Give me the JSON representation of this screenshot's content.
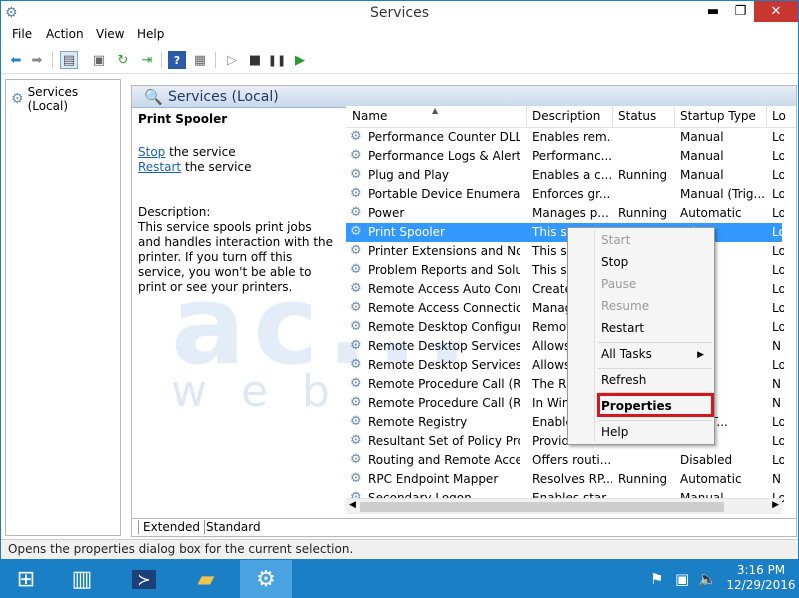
{
  "window": {
    "title": "Services",
    "minimize_glyph": "▬",
    "maximize_glyph": "❐",
    "close_glyph": "✕"
  },
  "menu": [
    "File",
    "Action",
    "View",
    "Help"
  ],
  "toolbar_icons": [
    "back-icon",
    "forward-icon",
    "show-hide-tree-icon",
    "properties-icon",
    "refresh-icon",
    "export-icon",
    "help-icon",
    "view-icon",
    "play-icon",
    "stop-icon",
    "pause-icon",
    "restart-icon"
  ],
  "tree": {
    "root_label": "Services (Local)"
  },
  "pane": {
    "header_title": "Services (Local)",
    "detail_title": "Print Spooler",
    "stop_link": "Stop",
    "stop_suffix": " the service",
    "restart_link": "Restart",
    "restart_suffix": " the service",
    "description_label": "Description:",
    "description_text": "This service spools print jobs and handles interaction with the printer. If you turn off this service, you won't be able to print or see your printers."
  },
  "columns": {
    "name": "Name",
    "description": "Description",
    "status": "Status",
    "startup_type": "Startup Type",
    "log_on": "Lo"
  },
  "rows": [
    {
      "name": "Performance Counter DLL ...",
      "description": "Enables rem...",
      "status": "",
      "startup": "Manual",
      "logon": "Lo"
    },
    {
      "name": "Performance Logs & Alerts",
      "description": "Performanc...",
      "status": "",
      "startup": "Manual",
      "logon": "Lo"
    },
    {
      "name": "Plug and Play",
      "description": "Enables a c...",
      "status": "Running",
      "startup": "Manual",
      "logon": "Lo"
    },
    {
      "name": "Portable Device Enumerator...",
      "description": "Enforces gr...",
      "status": "",
      "startup": "Manual (Trig...",
      "logon": "Lo"
    },
    {
      "name": "Power",
      "description": "Manages p...",
      "status": "Running",
      "startup": "Automatic",
      "logon": "Lo"
    },
    {
      "name": "Print Spooler",
      "description": "This se",
      "status": "",
      "startup": "atic",
      "logon": "Lo"
    },
    {
      "name": "Printer Extensions and Notif...",
      "description": "This se",
      "status": "",
      "startup": "l",
      "logon": "Lo"
    },
    {
      "name": "Problem Reports and Soluti...",
      "description": "This se",
      "status": "",
      "startup": "l",
      "logon": "Lo"
    },
    {
      "name": "Remote Access Auto Conne...",
      "description": "Create",
      "status": "",
      "startup": "l",
      "logon": "Lo"
    },
    {
      "name": "Remote Access Connection...",
      "description": "Manag",
      "status": "",
      "startup": "l",
      "logon": "Lo"
    },
    {
      "name": "Remote Desktop Configurat...",
      "description": "Remot",
      "status": "",
      "startup": "l",
      "logon": "Lo"
    },
    {
      "name": "Remote Desktop Services",
      "description": "Allows",
      "status": "",
      "startup": "l",
      "logon": "N"
    },
    {
      "name": "Remote Desktop Services U...",
      "description": "Allows",
      "status": "",
      "startup": "l",
      "logon": "Lo"
    },
    {
      "name": "Remote Procedure Call (RPC)",
      "description": "The RP",
      "status": "",
      "startup": "atic",
      "logon": "N"
    },
    {
      "name": "Remote Procedure Call (RP...",
      "description": "In Win",
      "status": "",
      "startup": "l",
      "logon": "N"
    },
    {
      "name": "Remote Registry",
      "description": "Enable",
      "status": "",
      "startup": "atic (T...",
      "logon": "Lo"
    },
    {
      "name": "Resultant Set of Policy Provi...",
      "description": "Provid",
      "status": "",
      "startup": "l",
      "logon": "Lo"
    },
    {
      "name": "Routing and Remote Access",
      "description": "Offers routi...",
      "status": "",
      "startup": "Disabled",
      "logon": "Lo"
    },
    {
      "name": "RPC Endpoint Mapper",
      "description": "Resolves RP...",
      "status": "Running",
      "startup": "Automatic",
      "logon": "N"
    },
    {
      "name": "Secondary Logon",
      "description": "Enables star...",
      "status": "",
      "startup": "Manual",
      "logon": "Lo"
    }
  ],
  "selected_row_index": 5,
  "tabs": [
    "Extended",
    "Standard"
  ],
  "context_menu": {
    "items": [
      {
        "label": "Start",
        "enabled": false
      },
      {
        "label": "Stop",
        "enabled": true
      },
      {
        "label": "Pause",
        "enabled": false
      },
      {
        "label": "Resume",
        "enabled": false
      },
      {
        "label": "Restart",
        "enabled": true
      },
      {
        "label": "All Tasks",
        "enabled": true,
        "submenu": true
      },
      {
        "label": "Refresh",
        "enabled": true
      },
      {
        "label": "Properties",
        "enabled": true,
        "bold": true
      },
      {
        "label": "Help",
        "enabled": true
      }
    ],
    "submenu_glyph": "▶"
  },
  "status_bar": "Opens the properties dialog box for the current selection.",
  "watermark": {
    "main": "ac...",
    "sub": "web"
  },
  "taskbar": {
    "clock_time": "3:16 PM",
    "clock_date": "12/29/2016"
  },
  "colors": {
    "taskbar": "#1b7fc5",
    "selection": "#3399ff",
    "highlight_box": "#d4161f",
    "close_button": "#c7372f"
  }
}
